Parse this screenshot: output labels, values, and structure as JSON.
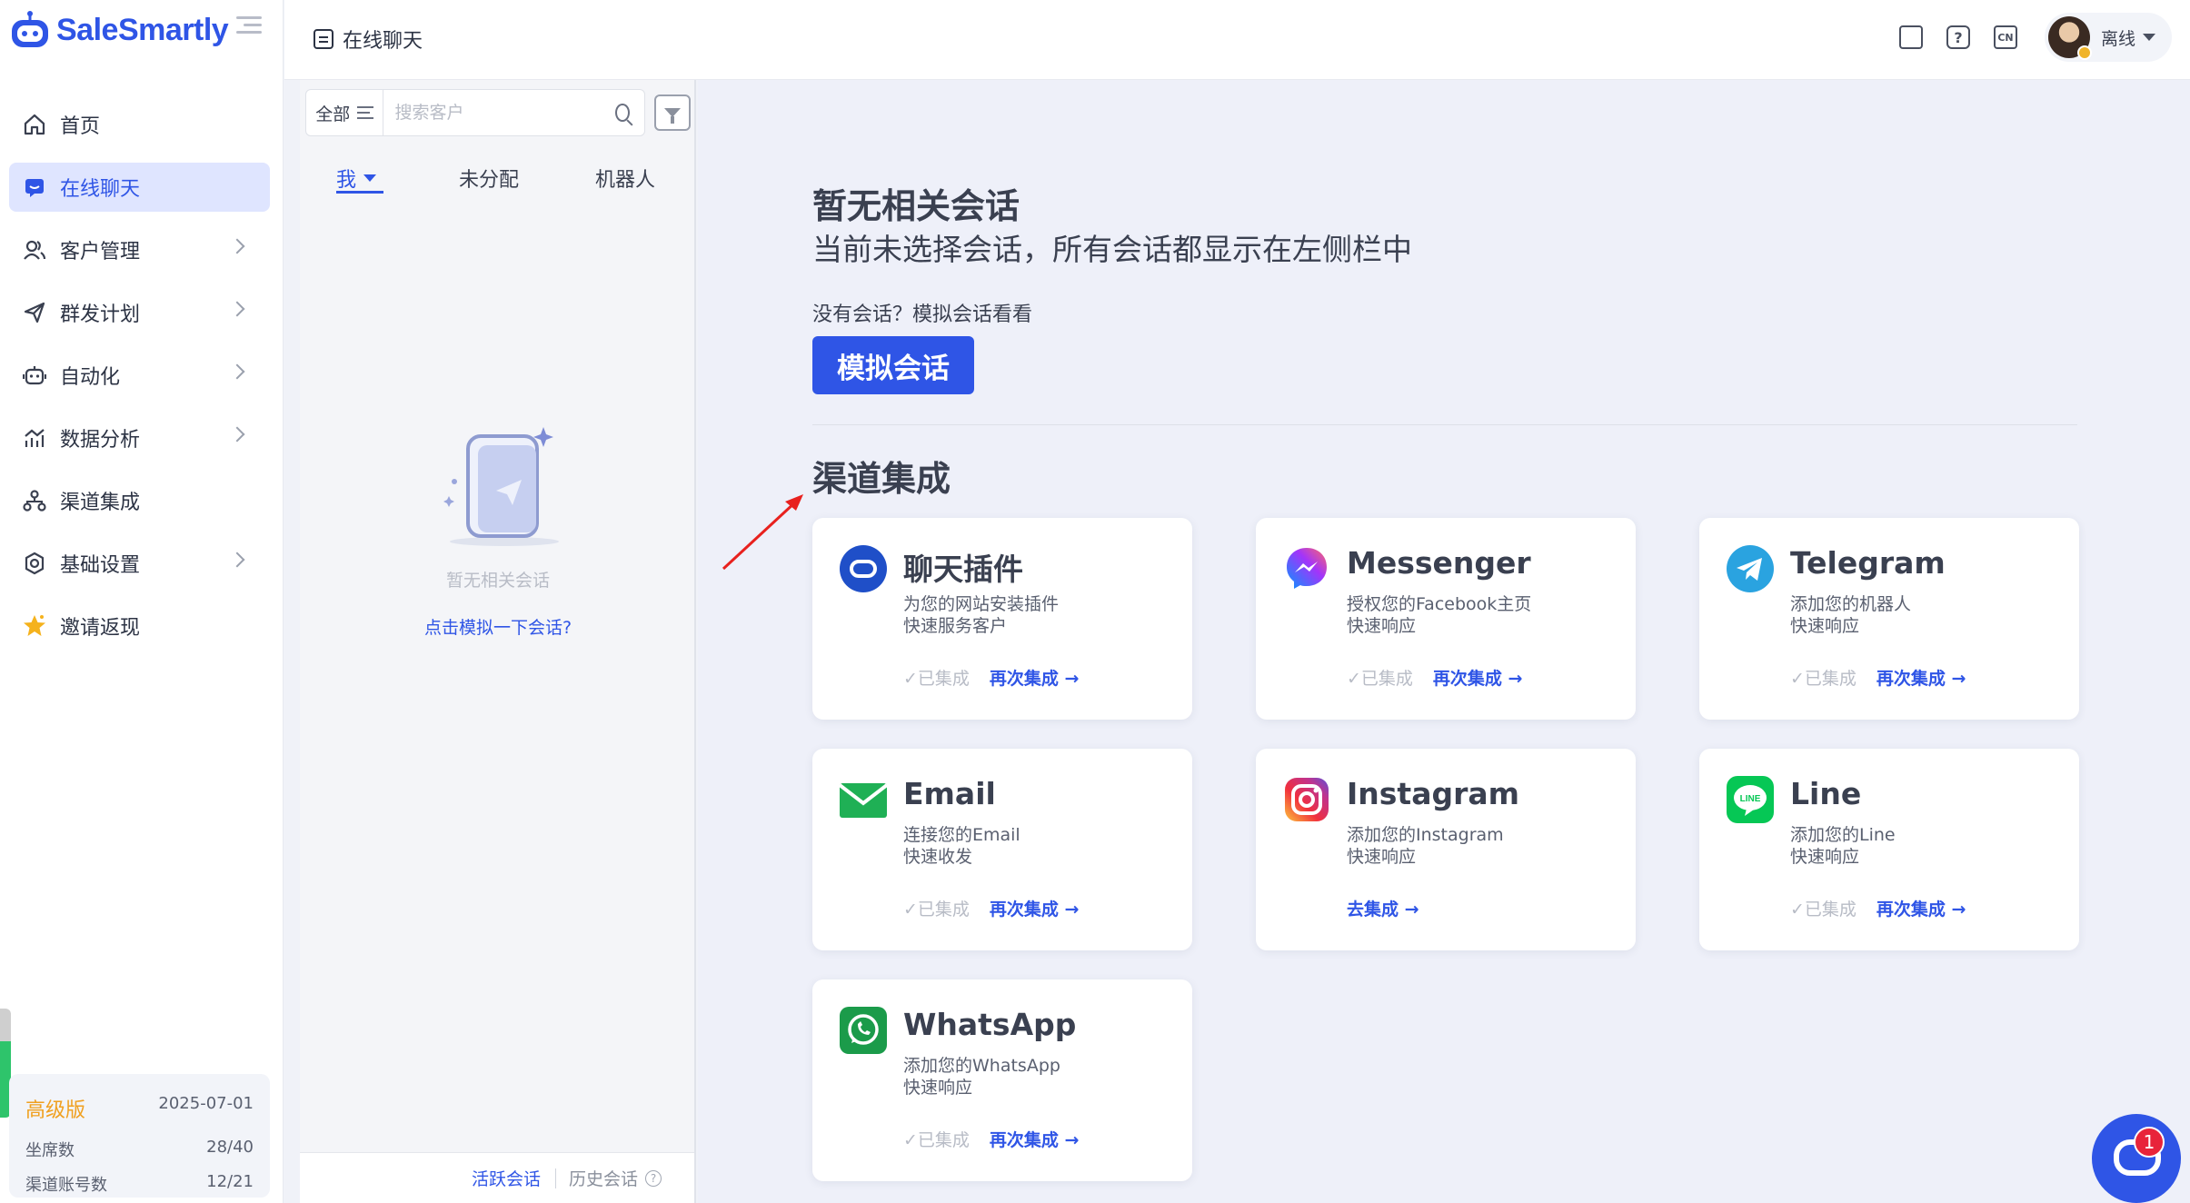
{
  "app": {
    "logo_text": "SaleSmartly"
  },
  "sidebar": {
    "items": [
      {
        "label": "首页",
        "icon": "home-icon"
      },
      {
        "label": "在线聊天",
        "icon": "chat-icon",
        "active": true
      },
      {
        "label": "客户管理",
        "icon": "users-icon"
      },
      {
        "label": "群发计划",
        "icon": "send-icon"
      },
      {
        "label": "自动化",
        "icon": "robot-icon"
      },
      {
        "label": "数据分析",
        "icon": "chart-icon"
      },
      {
        "label": "渠道集成",
        "icon": "channels-icon"
      },
      {
        "label": "基础设置",
        "icon": "settings-icon"
      },
      {
        "label": "邀请返现",
        "icon": "star-icon"
      }
    ],
    "plan": {
      "name": "高级版",
      "expiry": "2025-07-01",
      "seats_label": "坐席数",
      "seats_value": "28/40",
      "channels_label": "渠道账号数",
      "channels_value": "12/21"
    }
  },
  "header": {
    "title": "在线聊天",
    "icons": [
      "devices-icon",
      "help-icon",
      "language-icon"
    ],
    "language_code": "CN",
    "help_glyph": "?",
    "user_status": "离线"
  },
  "conversations": {
    "filter_label": "全部",
    "search_placeholder": "搜索客户",
    "tabs": [
      {
        "label": "我",
        "active": true
      },
      {
        "label": "未分配"
      },
      {
        "label": "机器人"
      }
    ],
    "empty_text": "暂无相关会话",
    "empty_link": "点击模拟一下会话?",
    "footer_active": "活跃会话",
    "footer_history": "历史会话"
  },
  "main": {
    "title": "暂无相关会话",
    "subtitle": "当前未选择会话，所有会话都显示在左侧栏中",
    "hint": "没有会话？模拟会话看看",
    "simulate_button": "模拟会话",
    "section_title": "渠道集成"
  },
  "channels": [
    {
      "name": "聊天插件",
      "desc1": "为您的网站安装插件",
      "desc2": "快速服务客户",
      "done": "✓已集成",
      "action": "再次集成",
      "icon": "chat-plugin-icon"
    },
    {
      "name": "Messenger",
      "desc1": "授权您的Facebook主页",
      "desc2": "快速响应",
      "done": "✓已集成",
      "action": "再次集成",
      "icon": "messenger-icon"
    },
    {
      "name": "Telegram",
      "desc1": "添加您的机器人",
      "desc2": "快速响应",
      "done": "✓已集成",
      "action": "再次集成",
      "icon": "telegram-icon"
    },
    {
      "name": "Email",
      "desc1": "连接您的Email",
      "desc2": "快速收发",
      "done": "✓已集成",
      "action": "再次集成",
      "icon": "email-icon"
    },
    {
      "name": "Instagram",
      "desc1": "添加您的Instagram",
      "desc2": "快速响应",
      "done": "",
      "action": "去集成",
      "icon": "instagram-icon"
    },
    {
      "name": "Line",
      "desc1": "添加您的Line",
      "desc2": "快速响应",
      "done": "✓已集成",
      "action": "再次集成",
      "icon": "line-icon"
    },
    {
      "name": "WhatsApp",
      "desc1": "添加您的WhatsApp",
      "desc2": "快速响应",
      "done": "✓已集成",
      "action": "再次集成",
      "icon": "whatsapp-icon"
    }
  ],
  "chat_widget": {
    "badge": "1"
  },
  "colors": {
    "accent": "#2f55e6",
    "plan": "#f0a020",
    "badge": "#e8243a"
  }
}
